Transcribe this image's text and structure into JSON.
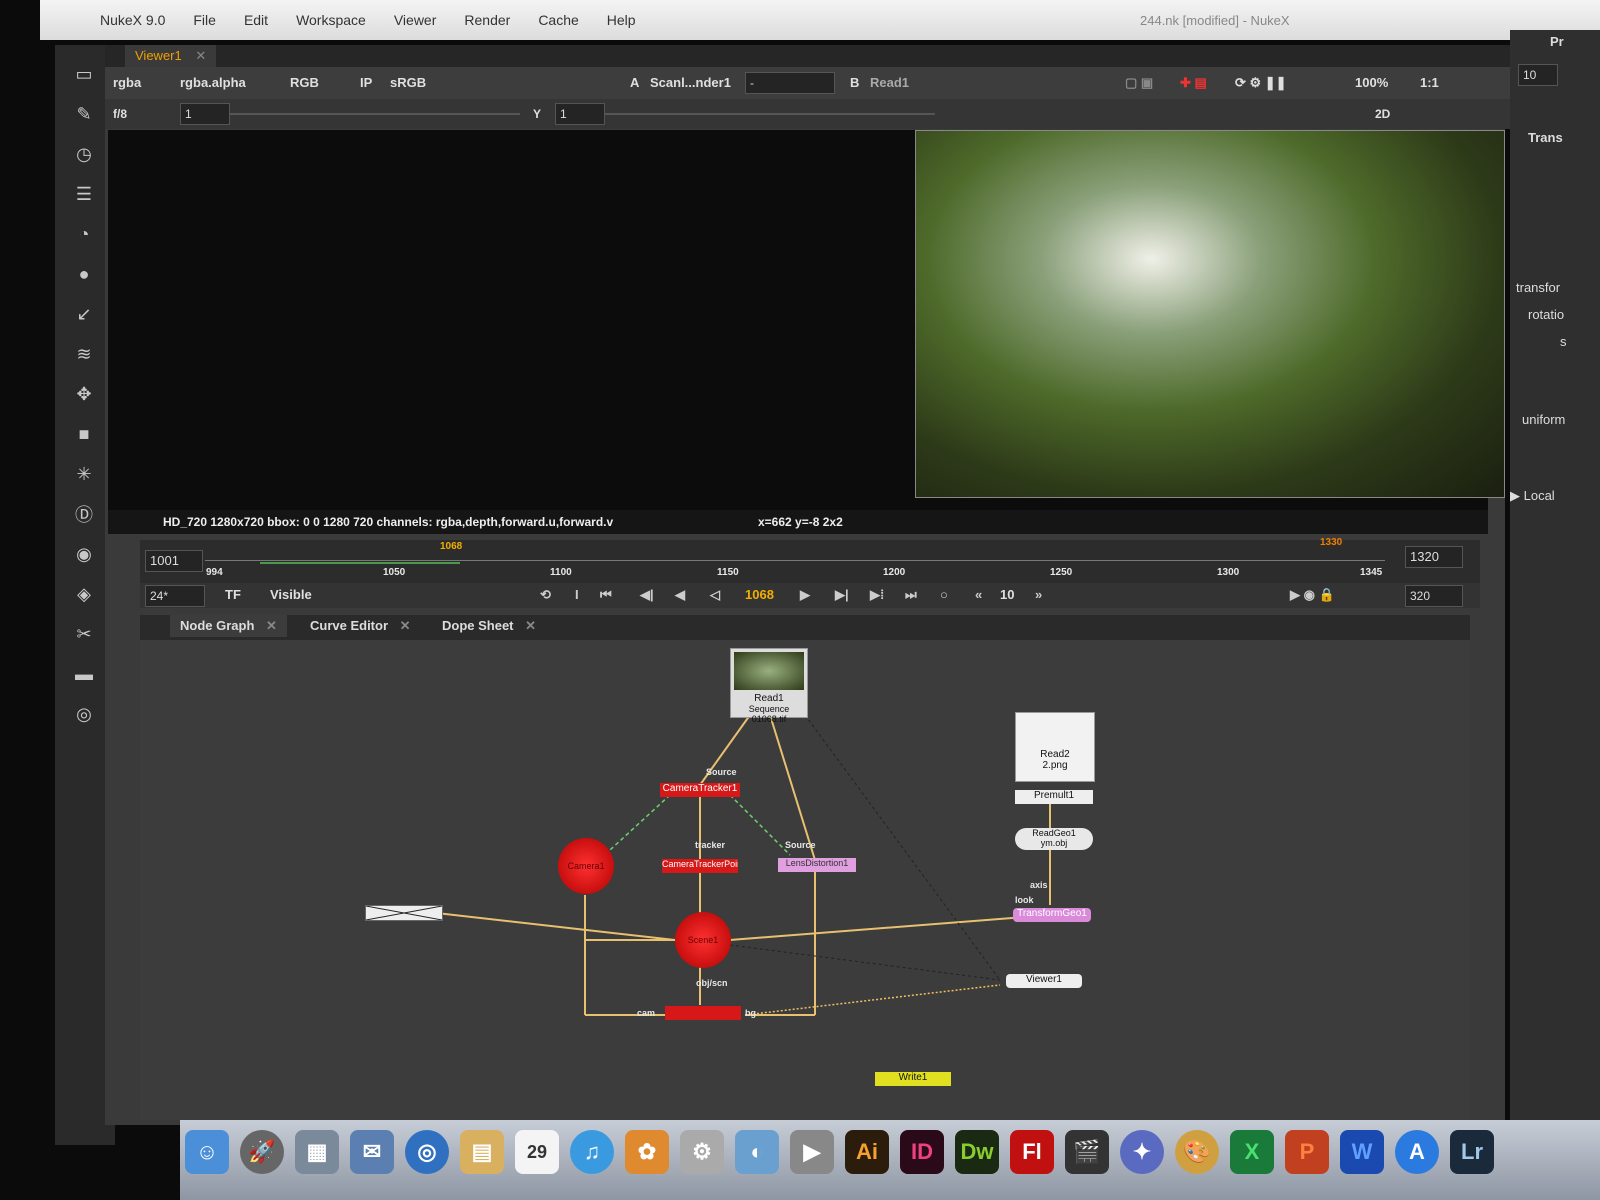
{
  "menubar": {
    "items": [
      "NukeX 9.0",
      "File",
      "Edit",
      "Workspace",
      "Viewer",
      "Render",
      "Cache",
      "Help"
    ],
    "title": "244.nk [modified] - NukeX"
  },
  "viewer": {
    "tab_label": "Viewer1",
    "channels": "rgba",
    "alpha": "rgba.alpha",
    "display": "RGB",
    "ip": "IP",
    "lut": "sRGB",
    "input_a": "Scanl...nder1",
    "input_a_letter": "A",
    "wipe_mode": "-",
    "input_b_letter": "B",
    "input_b": "Read1",
    "zoom": "100%",
    "proxy": "1:1",
    "view_mode": "2D",
    "fstop": "f/8",
    "gain": "1",
    "gamma_letter": "Y",
    "gamma": "1",
    "info": "HD_720 1280x720  bbox: 0 0 1280 720  channels: rgba,depth,forward.u,forward.v",
    "cursor": "x=662 y=-8 2x2"
  },
  "timeline": {
    "start_field": "1001",
    "end_field": "1320",
    "first": "994",
    "current_marker": "1068",
    "out_marker": "1330",
    "ticks": [
      "1050",
      "1100",
      "1150",
      "1200",
      "1250",
      "1300",
      "1345"
    ]
  },
  "playback": {
    "fps": "24*",
    "mode": "TF",
    "visible": "Visible",
    "frame": "1068",
    "step": "10",
    "end": "320"
  },
  "tabs": {
    "node_graph": "Node Graph",
    "curve_editor": "Curve Editor",
    "dope_sheet": "Dope Sheet"
  },
  "nodes": {
    "read1": "Read1",
    "read1_file": "Sequence 01068.tif",
    "read2": "Read2",
    "read2_file": "2.png",
    "premult": "Premult1",
    "readgeo": "ReadGeo1",
    "readgeo_file": "ym.obj",
    "transformgeo": "TransformGeo1",
    "viewer1": "Viewer1",
    "cameratracker": "CameraTracker1",
    "pointcloud": "CameraTrackerPointCloud1",
    "lensdistortion": "LensDistortion1",
    "camera": "Camera1",
    "scene": "Scene1",
    "write": "Write1",
    "labels": {
      "source": "Source",
      "tracker": "tracker",
      "source2": "Source",
      "objscn": "obj/scn",
      "cam": "cam",
      "bg": "bg",
      "axis": "axis",
      "look": "look"
    }
  },
  "right_panel": {
    "tab": "Pr",
    "title": "Trans",
    "field": "10",
    "rows": [
      "transfor",
      "rotatio",
      "s",
      "uniform",
      "Local"
    ]
  },
  "dock": {
    "apps": [
      "Finder",
      "Launchpad",
      "Photos",
      "Mail",
      "Safari",
      "Notes",
      "Calendar",
      "iTunes",
      "iPhoto",
      "Utilities",
      "Preview",
      "Ai",
      "ID",
      "Dw",
      "Fl",
      "Clapper",
      "Keynote",
      "Paint",
      "X",
      "P",
      "W",
      "App Store",
      "Lr"
    ],
    "calendar_day": "29"
  }
}
